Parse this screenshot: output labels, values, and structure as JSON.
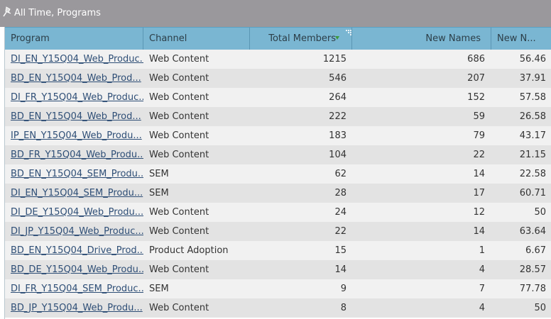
{
  "title_bar": {
    "text": "All Time, Programs"
  },
  "columns": [
    {
      "label": "Program"
    },
    {
      "label": "Channel"
    },
    {
      "label": "Total Members"
    },
    {
      "label": "New Names"
    },
    {
      "label": "New N..."
    }
  ],
  "rows": [
    [
      "DI_EN_Y15Q04_Web_Produc...",
      "Web Content",
      "1215",
      "686",
      "56.46"
    ],
    [
      "BD_EN_Y15Q04_Web_Prod...",
      "Web Content",
      "546",
      "207",
      "37.91"
    ],
    [
      "DI_FR_Y15Q04_Web_Produc...",
      "Web Content",
      "264",
      "152",
      "57.58"
    ],
    [
      "BD_EN_Y15Q04_Web_Prod...",
      "Web Content",
      "222",
      "59",
      "26.58"
    ],
    [
      "IP_EN_Y15Q04_Web_Produ...",
      "Web Content",
      "183",
      "79",
      "43.17"
    ],
    [
      "BD_FR_Y15Q04_Web_Produ...",
      "Web Content",
      "104",
      "22",
      "21.15"
    ],
    [
      "BD_EN_Y15Q04_SEM_Produ...",
      "SEM",
      "62",
      "14",
      "22.58"
    ],
    [
      "DI_EN_Y15Q04_SEM_Produ...",
      "SEM",
      "28",
      "17",
      "60.71"
    ],
    [
      "DI_DE_Y15Q04_Web_Produ...",
      "Web Content",
      "24",
      "12",
      "50"
    ],
    [
      "DI_JP_Y15Q04_Web_Produc...",
      "Web Content",
      "22",
      "14",
      "63.64"
    ],
    [
      "BD_EN_Y15Q04_Drive_Prod...",
      "Product Adoption",
      "15",
      "1",
      "6.67"
    ],
    [
      "BD_DE_Y15Q04_Web_Produ...",
      "Web Content",
      "14",
      "4",
      "28.57"
    ],
    [
      "DI_FR_Y15Q04_SEM_Produc...",
      "SEM",
      "9",
      "7",
      "77.78"
    ],
    [
      "BD_JP_Y15Q04_Web_Produ...",
      "Web Content",
      "8",
      "4",
      "50"
    ]
  ],
  "icons": {
    "title_icon": "pin-icon",
    "sort_icon": "sort-descending-icon"
  },
  "colors": {
    "title_bar": "#9a989c",
    "header": "#7ab6d2",
    "link": "#2e4e76",
    "row_odd": "#f1f1f1",
    "row_even": "#e3e3e3"
  }
}
